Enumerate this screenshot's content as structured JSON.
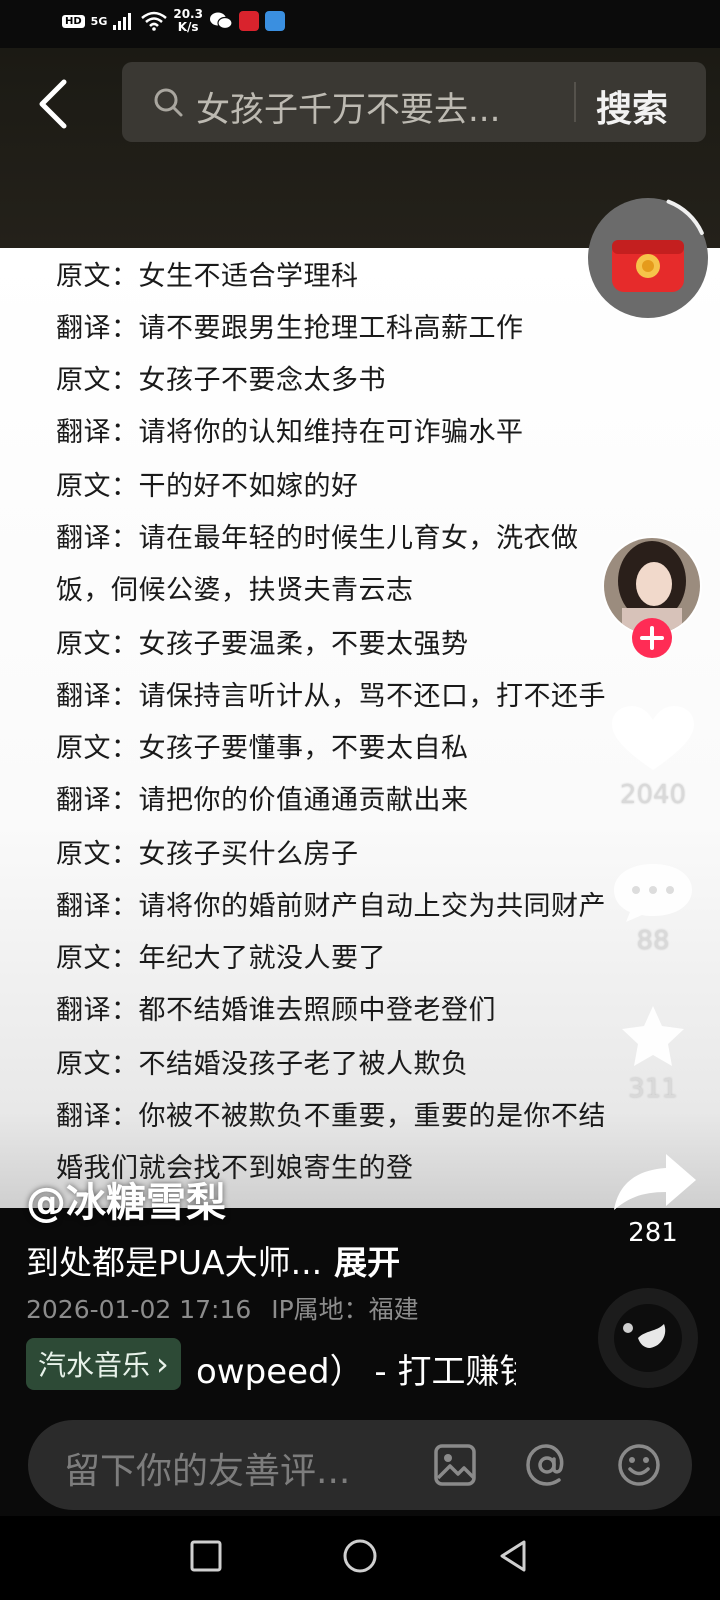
{
  "status_bar": {
    "hd": "HD",
    "network": "5G",
    "speed_value": "20.3",
    "speed_unit": "K/s"
  },
  "search": {
    "query": "女孩子千万不要去...",
    "button_label": "搜索"
  },
  "post_lines": [
    "原文：女生不适合学理科",
    "翻译：请不要跟男生抢理工科高薪工作",
    "原文：女孩子不要念太多书",
    "翻译：请将你的认知维持在可诈骗水平",
    "原文：干的好不如嫁的好",
    "翻译：请在最年轻的时候生儿育女，洗衣做",
    "饭，伺候公婆，扶贤夫青云志",
    "原文：女孩子要温柔，不要太强势",
    "翻译：请保持言听计从，骂不还口，打不还手",
    "原文：女孩子要懂事，不要太自私",
    "翻译：请把你的价值通通贡献出来",
    "原文：女孩子买什么房子",
    "翻译：请将你的婚前财产自动上交为共同财产",
    "原文：年纪大了就没人要了",
    "翻译：都不结婚谁去照顾中登老登们",
    "原文：不结婚没孩子老了被人欺负",
    "翻译：你被不被欺负不重要，重要的是你不结",
    "婚我们就会找不到娘寄生的登"
  ],
  "author": "@冰糖雪梨",
  "caption": {
    "text": "到处都是PUA大师...",
    "expand_label": "展开"
  },
  "meta": {
    "datetime": "2026-01-02 17:16",
    "ip_location": "IP属地：福建"
  },
  "music": {
    "tag_label": "汽水音乐",
    "tag_chevron": "›",
    "track_text": "owpeed） - 打工赚钱"
  },
  "actions": {
    "likes": "2040",
    "comments": "88",
    "favorites": "311",
    "shares": "281"
  },
  "comment_bar": {
    "placeholder": "留下你的友善评..."
  },
  "colors": {
    "header_bg": "#1f1d17",
    "follow_red": "#ff2c55",
    "music_tag_bg": "#2d4a36",
    "comment_bar_bg": "#2b2b2b"
  },
  "icons": [
    "back-icon",
    "search-icon",
    "red-envelope-icon",
    "plus-icon",
    "heart-icon",
    "comment-icon",
    "star-icon",
    "share-icon",
    "image-icon",
    "at-icon",
    "emoji-icon",
    "nav-square-icon",
    "nav-circle-icon",
    "nav-back-triangle-icon"
  ]
}
